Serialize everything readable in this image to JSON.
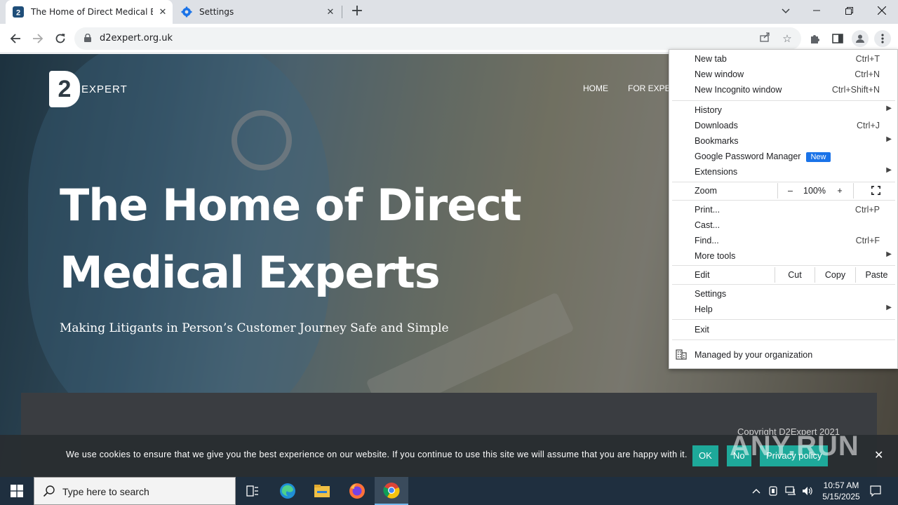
{
  "browser": {
    "tabs": [
      {
        "title": "The Home of Direct Medical Exp",
        "favicon": "d2-favicon",
        "active": true
      },
      {
        "title": "Settings",
        "favicon": "settings-gear-icon",
        "active": false
      }
    ],
    "url": "d2expert.org.uk"
  },
  "site": {
    "logo_mark": "2",
    "logo_word": "EXPERT",
    "nav": [
      "HOME",
      "FOR EXPER"
    ],
    "hero_title_line1": "The Home of Direct",
    "hero_title_line2": "Medical Experts",
    "hero_subtitle": "Making Litigants in Person’s Customer Journey Safe and Simple",
    "copyright": "Copyright D2Expert 2021"
  },
  "cookie": {
    "text": "We use cookies to ensure that we give you the best experience on our website. If you continue to use this site we will assume that you are happy with it.",
    "ok": "OK",
    "no": "No",
    "privacy": "Privacy policy",
    "close": "✕"
  },
  "watermark": "ANY.RUN",
  "menu": {
    "new_tab": "New tab",
    "new_tab_sc": "Ctrl+T",
    "new_window": "New window",
    "new_window_sc": "Ctrl+N",
    "incognito": "New Incognito window",
    "incognito_sc": "Ctrl+Shift+N",
    "history": "History",
    "downloads": "Downloads",
    "downloads_sc": "Ctrl+J",
    "bookmarks": "Bookmarks",
    "password_manager": "Google Password Manager",
    "new_badge": "New",
    "extensions": "Extensions",
    "zoom": "Zoom",
    "zoom_minus": "–",
    "zoom_value": "100%",
    "zoom_plus": "+",
    "print": "Print...",
    "print_sc": "Ctrl+P",
    "cast": "Cast...",
    "find": "Find...",
    "find_sc": "Ctrl+F",
    "more_tools": "More tools",
    "edit": "Edit",
    "cut": "Cut",
    "copy": "Copy",
    "paste": "Paste",
    "settings": "Settings",
    "help": "Help",
    "exit": "Exit",
    "managed": "Managed by your organization"
  },
  "taskbar": {
    "search_placeholder": "Type here to search",
    "time": "10:57 AM",
    "date": "5/15/2025"
  }
}
